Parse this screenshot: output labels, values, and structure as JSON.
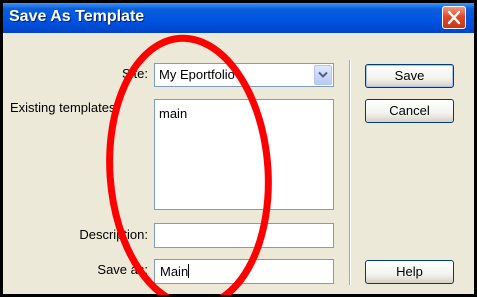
{
  "dialog": {
    "title": "Save As Template",
    "close_icon": "close-icon"
  },
  "form": {
    "site_label": "Site:",
    "site_value": "My Eportfolio",
    "existing_label": "Existing templates:",
    "existing_items": [
      "main"
    ],
    "description_label": "Description:",
    "description_value": "",
    "save_as_label": "Save as:",
    "save_as_value": "Main"
  },
  "buttons": {
    "save": "Save",
    "cancel": "Cancel",
    "help": "Help"
  },
  "colors": {
    "titlebar": "#0054e3",
    "dialog_bg": "#ece9d8",
    "annotation": "#ff0000"
  }
}
